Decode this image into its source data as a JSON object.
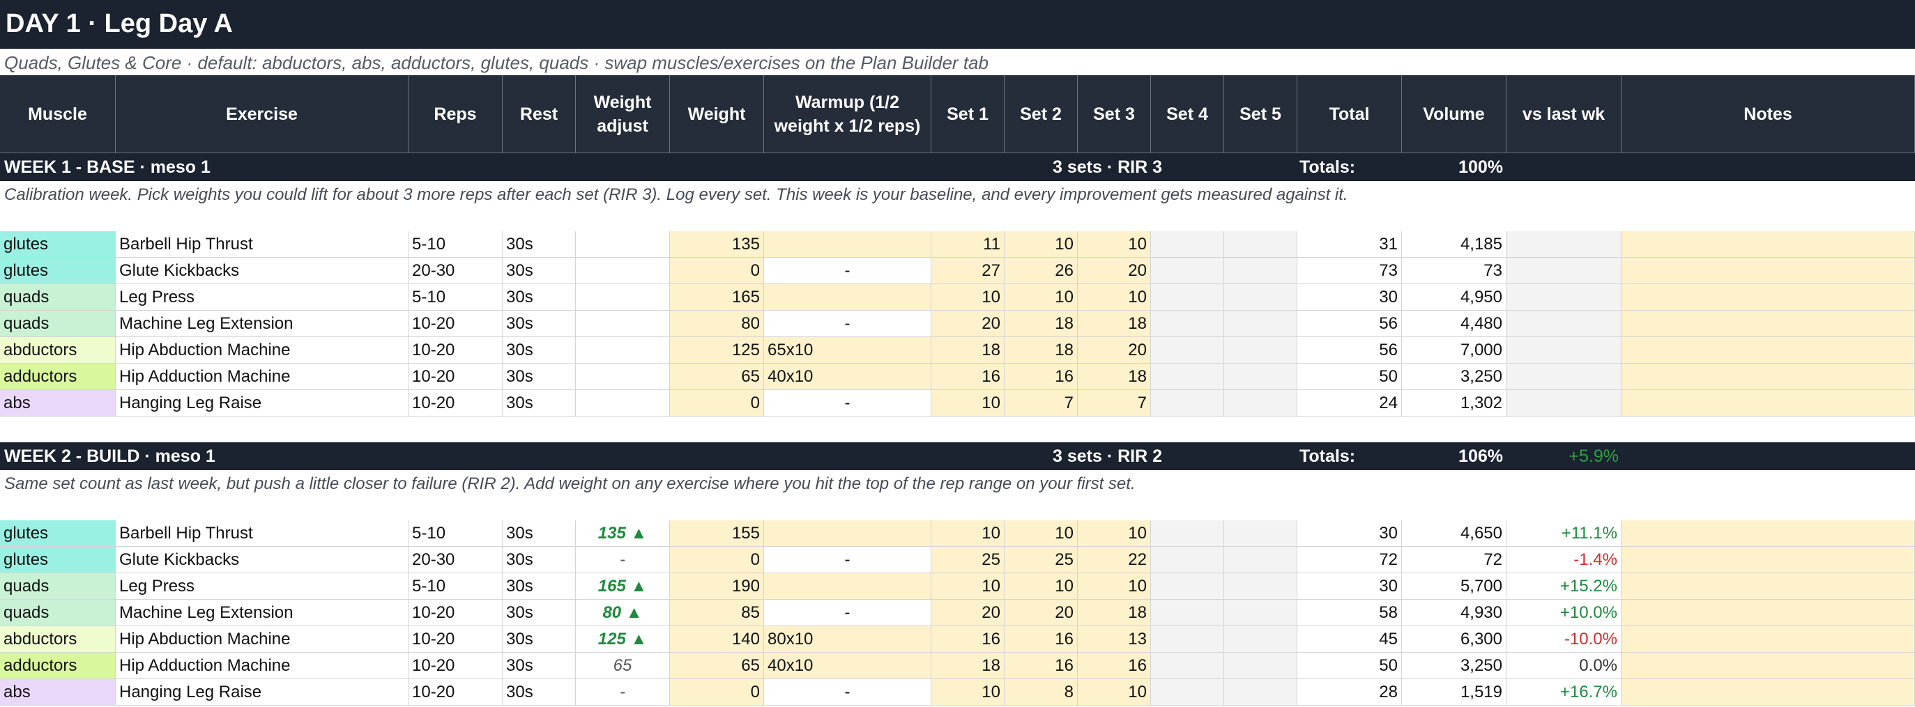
{
  "title": "DAY 1 · Leg Day A",
  "subtitle": "Quads, Glutes & Core  ·  default: abductors, abs, adductors, glutes, quads  ·  swap muscles/exercises on the Plan Builder tab",
  "columns": {
    "muscle": "Muscle",
    "exercise": "Exercise",
    "reps": "Reps",
    "rest": "Rest",
    "weight_adjust": "Weight adjust",
    "weight": "Weight",
    "warmup": "Warmup (1/2 weight x 1/2 reps)",
    "set1": "Set 1",
    "set2": "Set 2",
    "set3": "Set 3",
    "set4": "Set 4",
    "set5": "Set 5",
    "total": "Total",
    "volume": "Volume",
    "vs_last_wk": "vs last wk",
    "notes": "Notes"
  },
  "muscle_colors": {
    "glutes": "#9af0e2",
    "quads": "#c9f2d5",
    "abductors": "#eefcd0",
    "adductors": "#d9f79c",
    "abs": "#ead8fb"
  },
  "weeks": [
    {
      "title": "WEEK 1 - BASE · meso 1",
      "sets_rir": "3 sets · RIR 3",
      "totals_label": "Totals:",
      "totals_pct": "100%",
      "delta": "",
      "note": "Calibration week. Pick weights you could lift for about 3 more reps after each set (RIR 3). Log every set. This week is your baseline, and every improvement gets measured against it.",
      "rows": [
        {
          "muscle": "glutes",
          "exercise": "Barbell Hip Thrust",
          "reps": "5-10",
          "rest": "30s",
          "weight_adjust": "",
          "wa_type": "",
          "weight": "135",
          "warmup": "",
          "warmup_white": false,
          "set1": "11",
          "set2": "10",
          "set3": "10",
          "set4": "",
          "set5": "",
          "total": "31",
          "volume": "4,185",
          "vs": "",
          "vs_type": ""
        },
        {
          "muscle": "glutes",
          "exercise": "Glute Kickbacks",
          "reps": "20-30",
          "rest": "30s",
          "weight_adjust": "",
          "wa_type": "",
          "weight": "0",
          "warmup": "-",
          "warmup_white": true,
          "set1": "27",
          "set2": "26",
          "set3": "20",
          "set4": "",
          "set5": "",
          "total": "73",
          "volume": "73",
          "vs": "",
          "vs_type": ""
        },
        {
          "muscle": "quads",
          "exercise": "Leg Press",
          "reps": "5-10",
          "rest": "30s",
          "weight_adjust": "",
          "wa_type": "",
          "weight": "165",
          "warmup": "",
          "warmup_white": false,
          "set1": "10",
          "set2": "10",
          "set3": "10",
          "set4": "",
          "set5": "",
          "total": "30",
          "volume": "4,950",
          "vs": "",
          "vs_type": ""
        },
        {
          "muscle": "quads",
          "exercise": "Machine Leg Extension",
          "reps": "10-20",
          "rest": "30s",
          "weight_adjust": "",
          "wa_type": "",
          "weight": "80",
          "warmup": "-",
          "warmup_white": true,
          "set1": "20",
          "set2": "18",
          "set3": "18",
          "set4": "",
          "set5": "",
          "total": "56",
          "volume": "4,480",
          "vs": "",
          "vs_type": ""
        },
        {
          "muscle": "abductors",
          "exercise": "Hip Abduction Machine",
          "reps": "10-20",
          "rest": "30s",
          "weight_adjust": "",
          "wa_type": "",
          "weight": "125",
          "warmup": "65x10",
          "warmup_white": false,
          "set1": "18",
          "set2": "18",
          "set3": "20",
          "set4": "",
          "set5": "",
          "total": "56",
          "volume": "7,000",
          "vs": "",
          "vs_type": ""
        },
        {
          "muscle": "adductors",
          "exercise": "Hip Adduction Machine",
          "reps": "10-20",
          "rest": "30s",
          "weight_adjust": "",
          "wa_type": "",
          "weight": "65",
          "warmup": "40x10",
          "warmup_white": false,
          "set1": "16",
          "set2": "16",
          "set3": "18",
          "set4": "",
          "set5": "",
          "total": "50",
          "volume": "3,250",
          "vs": "",
          "vs_type": ""
        },
        {
          "muscle": "abs",
          "exercise": "Hanging Leg Raise",
          "reps": "10-20",
          "rest": "30s",
          "weight_adjust": "",
          "wa_type": "",
          "weight": "0",
          "warmup": "-",
          "warmup_white": true,
          "set1": "10",
          "set2": "7",
          "set3": "7",
          "set4": "",
          "set5": "",
          "total": "24",
          "volume": "1,302",
          "vs": "",
          "vs_type": ""
        }
      ]
    },
    {
      "title": "WEEK 2 - BUILD · meso 1",
      "sets_rir": "3 sets · RIR 2",
      "totals_label": "Totals:",
      "totals_pct": "106%",
      "delta": "+5.9%",
      "note": "Same set count as last week, but push a little closer to failure (RIR 2). Add weight on any exercise where you hit the top of the rep range on your first set.",
      "rows": [
        {
          "muscle": "glutes",
          "exercise": "Barbell Hip Thrust",
          "reps": "5-10",
          "rest": "30s",
          "weight_adjust": "135 ▲",
          "wa_type": "up",
          "weight": "155",
          "warmup": "",
          "warmup_white": false,
          "set1": "10",
          "set2": "10",
          "set3": "10",
          "set4": "",
          "set5": "",
          "total": "30",
          "volume": "4,650",
          "vs": "+11.1%",
          "vs_type": "pos"
        },
        {
          "muscle": "glutes",
          "exercise": "Glute Kickbacks",
          "reps": "20-30",
          "rest": "30s",
          "weight_adjust": "-",
          "wa_type": "same",
          "weight": "0",
          "warmup": "-",
          "warmup_white": true,
          "set1": "25",
          "set2": "25",
          "set3": "22",
          "set4": "",
          "set5": "",
          "total": "72",
          "volume": "72",
          "vs": "-1.4%",
          "vs_type": "neg"
        },
        {
          "muscle": "quads",
          "exercise": "Leg Press",
          "reps": "5-10",
          "rest": "30s",
          "weight_adjust": "165 ▲",
          "wa_type": "up",
          "weight": "190",
          "warmup": "",
          "warmup_white": false,
          "set1": "10",
          "set2": "10",
          "set3": "10",
          "set4": "",
          "set5": "",
          "total": "30",
          "volume": "5,700",
          "vs": "+15.2%",
          "vs_type": "pos"
        },
        {
          "muscle": "quads",
          "exercise": "Machine Leg Extension",
          "reps": "10-20",
          "rest": "30s",
          "weight_adjust": "80 ▲",
          "wa_type": "up",
          "weight": "85",
          "warmup": "-",
          "warmup_white": true,
          "set1": "20",
          "set2": "20",
          "set3": "18",
          "set4": "",
          "set5": "",
          "total": "58",
          "volume": "4,930",
          "vs": "+10.0%",
          "vs_type": "pos"
        },
        {
          "muscle": "abductors",
          "exercise": "Hip Abduction Machine",
          "reps": "10-20",
          "rest": "30s",
          "weight_adjust": "125 ▲",
          "wa_type": "up",
          "weight": "140",
          "warmup": "80x10",
          "warmup_white": false,
          "set1": "16",
          "set2": "16",
          "set3": "13",
          "set4": "",
          "set5": "",
          "total": "45",
          "volume": "6,300",
          "vs": "-10.0%",
          "vs_type": "neg"
        },
        {
          "muscle": "adductors",
          "exercise": "Hip Adduction Machine",
          "reps": "10-20",
          "rest": "30s",
          "weight_adjust": "65",
          "wa_type": "same",
          "weight": "65",
          "warmup": "40x10",
          "warmup_white": false,
          "set1": "18",
          "set2": "16",
          "set3": "16",
          "set4": "",
          "set5": "",
          "total": "50",
          "volume": "3,250",
          "vs": "0.0%",
          "vs_type": "zero"
        },
        {
          "muscle": "abs",
          "exercise": "Hanging Leg Raise",
          "reps": "10-20",
          "rest": "30s",
          "weight_adjust": "-",
          "wa_type": "same",
          "weight": "0",
          "warmup": "-",
          "warmup_white": true,
          "set1": "10",
          "set2": "8",
          "set3": "10",
          "set4": "",
          "set5": "",
          "total": "28",
          "volume": "1,519",
          "vs": "+16.7%",
          "vs_type": "pos"
        }
      ]
    }
  ]
}
